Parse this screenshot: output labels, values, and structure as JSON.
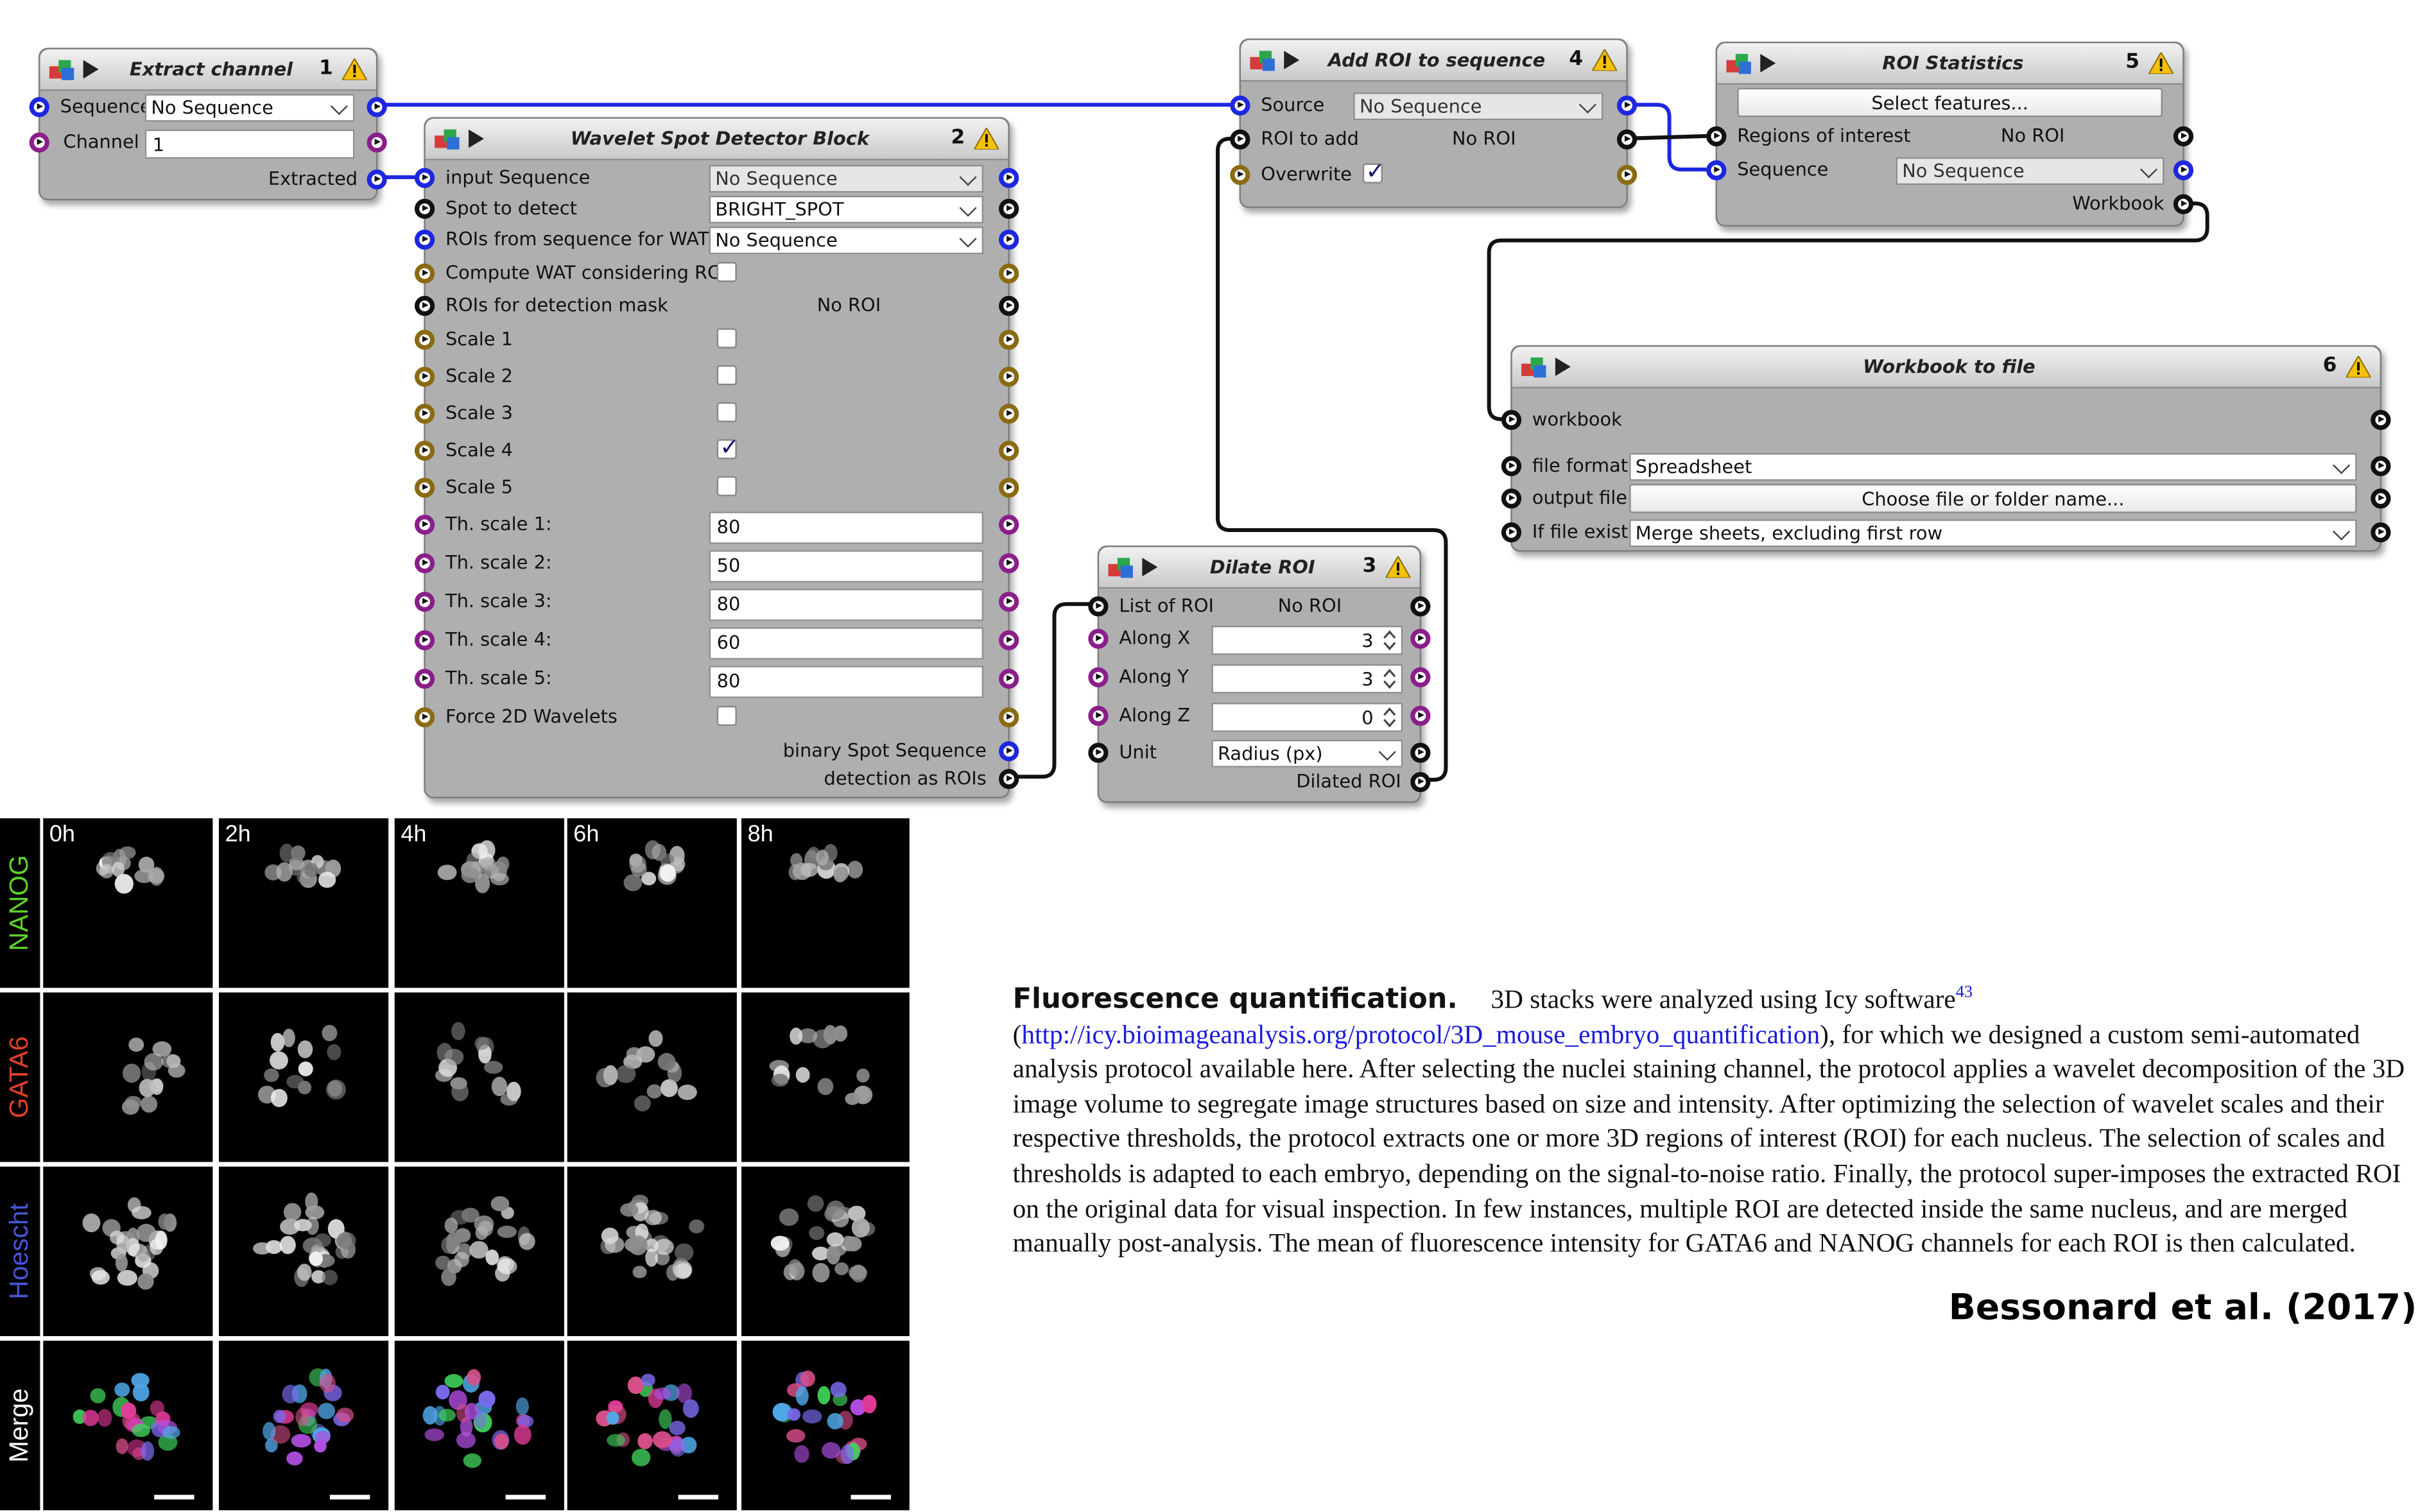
{
  "colors": {
    "wire_blue": "#1d27e0",
    "wire_black": "#111111",
    "port_purple": "#8a1f8a",
    "port_olive": "#8a6a12",
    "block_bg": "#afafaf"
  },
  "icons": {
    "block_logo": "icy-logo-icon",
    "run": "play-icon",
    "warning": "warning-icon"
  },
  "blocks": {
    "extract": {
      "title": "Extract channel",
      "number": "1",
      "sequence_label": "Sequence",
      "sequence_value": "No Sequence",
      "channel_label": "Channel",
      "channel_value": "1",
      "out_label": "Extracted"
    },
    "wavelet": {
      "title": "Wavelet Spot Detector Block",
      "number": "2",
      "rows": [
        {
          "label": "input Sequence",
          "value": "No Sequence"
        },
        {
          "label": "Spot to detect",
          "value": "BRIGHT_SPOT"
        },
        {
          "label": "ROIs from sequence for WAT",
          "value": "No Sequence"
        },
        {
          "label": "Compute WAT considering ROI",
          "checked": false
        },
        {
          "label": "ROIs for detection mask",
          "value": "No ROI"
        },
        {
          "label": "Scale 1",
          "checked": false
        },
        {
          "label": "Scale 2",
          "checked": false
        },
        {
          "label": "Scale 3",
          "checked": false
        },
        {
          "label": "Scale 4",
          "checked": true
        },
        {
          "label": "Scale 5",
          "checked": false
        },
        {
          "label": "Th. scale 1:",
          "value": "80"
        },
        {
          "label": "Th. scale 2:",
          "value": "50"
        },
        {
          "label": "Th. scale 3:",
          "value": "80"
        },
        {
          "label": "Th. scale 4:",
          "value": "60"
        },
        {
          "label": "Th. scale 5:",
          "value": "80"
        },
        {
          "label": "Force 2D Wavelets",
          "checked": false
        }
      ],
      "out1": "binary Spot Sequence",
      "out2": "detection as ROIs",
      "check_mark": "✓"
    },
    "dilate": {
      "title": "Dilate ROI",
      "number": "3",
      "list_label": "List of ROI",
      "list_value": "No ROI",
      "x_label": "Along X",
      "x_value": "3",
      "y_label": "Along Y",
      "y_value": "3",
      "z_label": "Along Z",
      "z_value": "0",
      "unit_label": "Unit",
      "unit_value": "Radius (px)",
      "out_label": "Dilated ROI"
    },
    "addroi": {
      "title": "Add ROI to sequence",
      "number": "4",
      "source_label": "Source",
      "source_value": "No Sequence",
      "roi_label": "ROI to add",
      "roi_value": "No ROI",
      "overwrite_label": "Overwrite",
      "overwrite_checked": true
    },
    "stats": {
      "title": "ROI Statistics",
      "number": "5",
      "button": "Select features...",
      "regions_label": "Regions of interest",
      "regions_value": "No ROI",
      "sequence_label": "Sequence",
      "sequence_value": "No Sequence",
      "out_label": "Workbook"
    },
    "workbook": {
      "title": "Workbook to file",
      "number": "6",
      "workbook_label": "workbook",
      "format_label": "file format",
      "format_value": "Spreadsheet",
      "output_label": "output file",
      "output_button": "Choose file or folder name...",
      "exists_label": "If file exists",
      "exists_value": "Merge sheets, excluding first row"
    }
  },
  "figure": {
    "timepoints": [
      "0h",
      "2h",
      "4h",
      "6h",
      "8h"
    ],
    "rows": [
      {
        "label": "NANOG",
        "color": "#5fd12a"
      },
      {
        "label": "GATA6",
        "color": "#e0402a"
      },
      {
        "label": "Hoescht",
        "color": "#4a55d6"
      },
      {
        "label": "Merge",
        "color": "#ffffff"
      }
    ]
  },
  "paragraph": {
    "heading": "Fluorescence quantification.",
    "text1": "3D stacks were analyzed using Icy software",
    "ref": "43",
    "text2": " (",
    "link": "http://icy.bioimageanalysis.org/protocol/3D_mouse_embryo_quantification",
    "text3": "), for which we designed a custom semi-automated analysis protocol available here. After selecting the nuclei staining channel, the protocol applies a wavelet decomposition of the 3D image volume to segregate image structures based on size and intensity. After optimizing the selection of wavelet scales and their respective thresholds, the protocol extracts one or more 3D regions of interest (ROI) for each nucleus. The selection of scales and thresholds is adapted to each embryo, depending on the signal-to-noise ratio. Finally, the protocol super-imposes the extracted ROI on the original data for visual inspection. In few instances, multiple ROI are detected inside the same nucleus, and are merged manually post-analysis. The mean of fluorescence intensity for GATA6 and NANOG channels for each ROI is then calculated."
  },
  "citation": "Bessonard et al. (2017)"
}
